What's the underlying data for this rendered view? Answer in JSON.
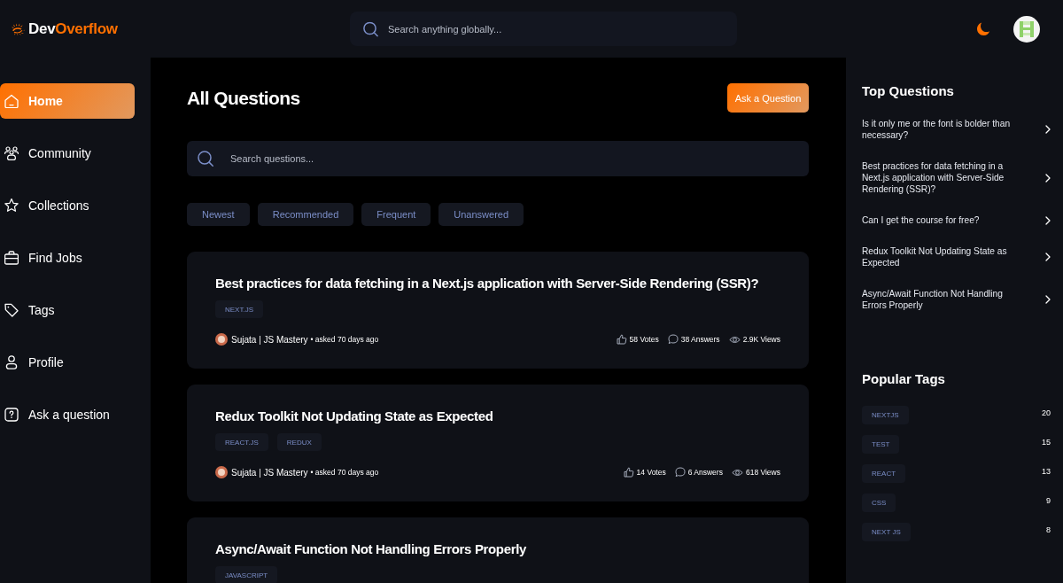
{
  "header": {
    "logo": {
      "main": "Dev",
      "accent": "Overflow"
    },
    "search": {
      "placeholder": "Search anything globally..."
    }
  },
  "sidebar": {
    "items": [
      {
        "label": "Home",
        "selected": true
      },
      {
        "label": "Community",
        "selected": false
      },
      {
        "label": "Collections",
        "selected": false
      },
      {
        "label": "Find Jobs",
        "selected": false
      },
      {
        "label": "Tags",
        "selected": false
      },
      {
        "label": "Profile",
        "selected": false
      },
      {
        "label": "Ask a question",
        "selected": false
      }
    ]
  },
  "main": {
    "title": "All Questions",
    "ask_button": "Ask a Question",
    "search": {
      "placeholder": "Search questions..."
    },
    "filters": [
      {
        "label": "Newest",
        "selected": false
      },
      {
        "label": "Recommended",
        "selected": false
      },
      {
        "label": "Frequent",
        "selected": false
      },
      {
        "label": "Unanswered",
        "selected": false
      }
    ],
    "questions": [
      {
        "title": "Best practices for data fetching in a Next.js application with Server-Side Rendering (SSR)?",
        "tags": [
          "NEXT.JS"
        ],
        "author": "Sujata | JS Mastery",
        "asked": "• asked 70 days ago",
        "votes": "58 Votes",
        "answers": "38 Answers",
        "views": "2.9K Views"
      },
      {
        "title": "Redux Toolkit Not Updating State as Expected",
        "tags": [
          "REACT.JS",
          "REDUX"
        ],
        "author": "Sujata | JS Mastery",
        "asked": "• asked 70 days ago",
        "votes": "14 Votes",
        "answers": "6 Answers",
        "views": "618 Views"
      },
      {
        "title": "Async/Await Function Not Handling Errors Properly",
        "tags": [
          "JAVASCRIPT"
        ]
      }
    ]
  },
  "right_sidebar": {
    "top_questions": {
      "title": "Top Questions",
      "items": [
        "Is it only me or the font is bolder than necessary?",
        "Best practices for data fetching in a Next.js application with Server-Side Rendering (SSR)?",
        "Can I get the course for free?",
        "Redux Toolkit Not Updating State as Expected",
        "Async/Await Function Not Handling Errors Properly"
      ]
    },
    "popular_tags": {
      "title": "Popular Tags",
      "items": [
        {
          "name": "NEXTJS",
          "count": "20"
        },
        {
          "name": "TEST",
          "count": "15"
        },
        {
          "name": "REACT",
          "count": "13"
        },
        {
          "name": "CSS",
          "count": "9"
        },
        {
          "name": "NEXT JS",
          "count": "8"
        }
      ]
    }
  }
}
